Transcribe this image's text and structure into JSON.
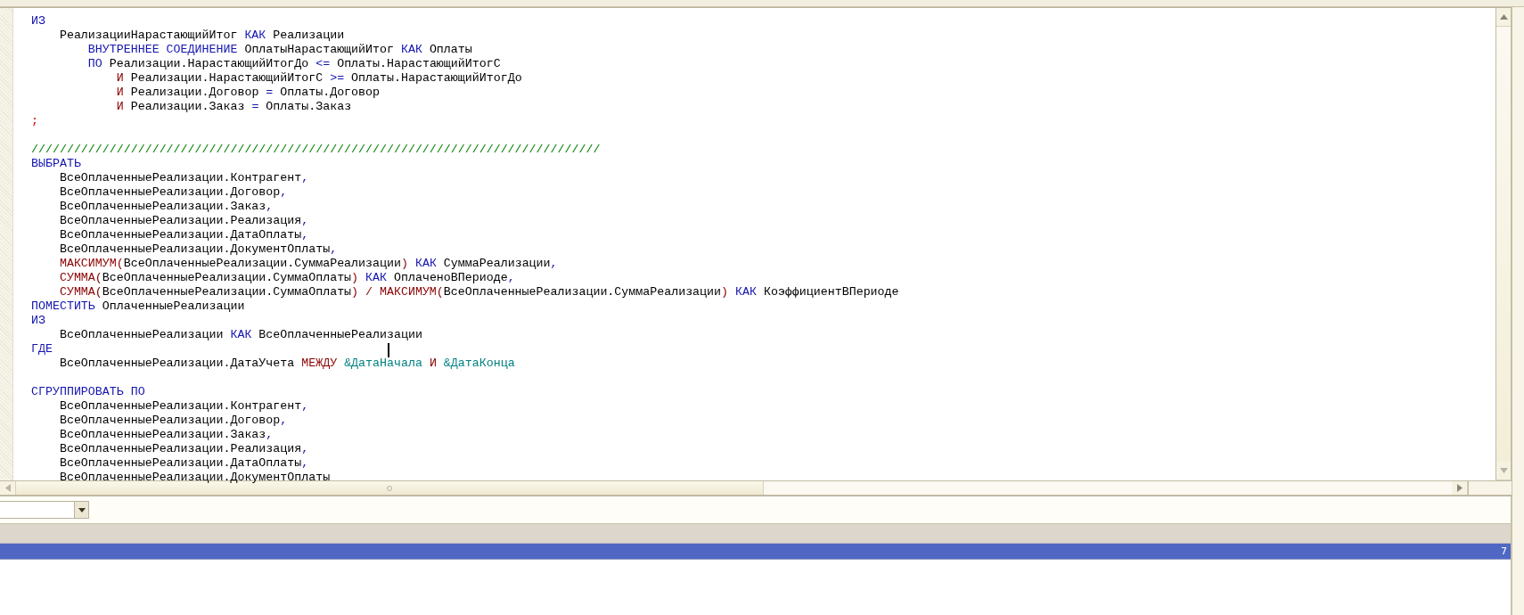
{
  "editor": {
    "lines": [
      {
        "kind": "code",
        "tokens": [
          {
            "kind": "keyword",
            "text": "ИЗ"
          }
        ]
      },
      {
        "kind": "code",
        "tokens": [
          {
            "kind": "plain",
            "text": "    РеализацииНарастающийИтог "
          },
          {
            "kind": "keyword",
            "text": "КАК"
          },
          {
            "kind": "plain",
            "text": " Реализации"
          }
        ]
      },
      {
        "kind": "code",
        "tokens": [
          {
            "kind": "keyword",
            "text": "        ВНУТРЕННЕЕ СОЕДИНЕНИЕ"
          },
          {
            "kind": "plain",
            "text": " ОплатыНарастающийИтог "
          },
          {
            "kind": "keyword",
            "text": "КАК"
          },
          {
            "kind": "plain",
            "text": " Оплаты"
          }
        ]
      },
      {
        "kind": "code",
        "tokens": [
          {
            "kind": "keyword",
            "text": "        ПО"
          },
          {
            "kind": "plain",
            "text": " Реализации.НарастающийИтогДо "
          },
          {
            "kind": "operator",
            "text": "<="
          },
          {
            "kind": "plain",
            "text": " Оплаты.НарастающийИтогС"
          }
        ]
      },
      {
        "kind": "code",
        "tokens": [
          {
            "kind": "function",
            "text": "            И"
          },
          {
            "kind": "plain",
            "text": " Реализации.НарастающийИтогС "
          },
          {
            "kind": "operator",
            "text": ">="
          },
          {
            "kind": "plain",
            "text": " Оплаты.НарастающийИтогДо"
          }
        ]
      },
      {
        "kind": "code",
        "tokens": [
          {
            "kind": "function",
            "text": "            И"
          },
          {
            "kind": "plain",
            "text": " Реализации.Договор "
          },
          {
            "kind": "operator",
            "text": "="
          },
          {
            "kind": "plain",
            "text": " Оплаты.Договор"
          }
        ]
      },
      {
        "kind": "code",
        "tokens": [
          {
            "kind": "function",
            "text": "            И"
          },
          {
            "kind": "plain",
            "text": " Реализации.Заказ "
          },
          {
            "kind": "operator",
            "text": "="
          },
          {
            "kind": "plain",
            "text": " Оплаты.Заказ"
          }
        ]
      },
      {
        "kind": "code",
        "tokens": [
          {
            "kind": "semicolon",
            "text": ";"
          }
        ]
      },
      {
        "kind": "blank"
      },
      {
        "kind": "code",
        "tokens": [
          {
            "kind": "comment",
            "text": "////////////////////////////////////////////////////////////////////////////////"
          }
        ]
      },
      {
        "kind": "code",
        "tokens": [
          {
            "kind": "keyword",
            "text": "ВЫБРАТЬ"
          }
        ]
      },
      {
        "kind": "code",
        "tokens": [
          {
            "kind": "plain",
            "text": "    ВсеОплаченныеРеализации.Контрагент"
          },
          {
            "kind": "operator",
            "text": ","
          }
        ]
      },
      {
        "kind": "code",
        "tokens": [
          {
            "kind": "plain",
            "text": "    ВсеОплаченныеРеализации.Договор"
          },
          {
            "kind": "operator",
            "text": ","
          }
        ]
      },
      {
        "kind": "code",
        "tokens": [
          {
            "kind": "plain",
            "text": "    ВсеОплаченныеРеализации.Заказ"
          },
          {
            "kind": "operator",
            "text": ","
          }
        ]
      },
      {
        "kind": "code",
        "tokens": [
          {
            "kind": "plain",
            "text": "    ВсеОплаченныеРеализации.Реализация"
          },
          {
            "kind": "operator",
            "text": ","
          }
        ]
      },
      {
        "kind": "code",
        "tokens": [
          {
            "kind": "plain",
            "text": "    ВсеОплаченныеРеализации.ДатаОплаты"
          },
          {
            "kind": "operator",
            "text": ","
          }
        ]
      },
      {
        "kind": "code",
        "tokens": [
          {
            "kind": "plain",
            "text": "    ВсеОплаченныеРеализации.ДокументОплаты"
          },
          {
            "kind": "operator",
            "text": ","
          }
        ]
      },
      {
        "kind": "code",
        "tokens": [
          {
            "kind": "function",
            "text": "    МАКСИМУМ("
          },
          {
            "kind": "plain",
            "text": "ВсеОплаченныеРеализации.СуммаРеализации"
          },
          {
            "kind": "function",
            "text": ") "
          },
          {
            "kind": "keyword",
            "text": "КАК"
          },
          {
            "kind": "plain",
            "text": " СуммаРеализации"
          },
          {
            "kind": "operator",
            "text": ","
          }
        ]
      },
      {
        "kind": "code",
        "tokens": [
          {
            "kind": "function",
            "text": "    СУММА("
          },
          {
            "kind": "plain",
            "text": "ВсеОплаченныеРеализации.СуммаОплаты"
          },
          {
            "kind": "function",
            "text": ") "
          },
          {
            "kind": "keyword",
            "text": "КАК"
          },
          {
            "kind": "plain",
            "text": " ОплаченоВПериоде"
          },
          {
            "kind": "operator",
            "text": ","
          }
        ]
      },
      {
        "kind": "code",
        "tokens": [
          {
            "kind": "function",
            "text": "    СУММА("
          },
          {
            "kind": "plain",
            "text": "ВсеОплаченныеРеализации.СуммаОплаты"
          },
          {
            "kind": "function",
            "text": ") / МАКСИМУМ("
          },
          {
            "kind": "plain",
            "text": "ВсеОплаченныеРеализации.СуммаРеализации"
          },
          {
            "kind": "function",
            "text": ") "
          },
          {
            "kind": "keyword",
            "text": "КАК"
          },
          {
            "kind": "plain",
            "text": " КоэффициентВПериоде"
          }
        ]
      },
      {
        "kind": "code",
        "tokens": [
          {
            "kind": "keyword",
            "text": "ПОМЕСТИТЬ"
          },
          {
            "kind": "plain",
            "text": " ОплаченныеРеализации"
          }
        ]
      },
      {
        "kind": "code",
        "tokens": [
          {
            "kind": "keyword",
            "text": "ИЗ"
          }
        ]
      },
      {
        "kind": "code",
        "tokens": [
          {
            "kind": "plain",
            "text": "    ВсеОплаченныеРеализации "
          },
          {
            "kind": "keyword",
            "text": "КАК"
          },
          {
            "kind": "plain",
            "text": " ВсеОплаченныеРеализации"
          }
        ]
      },
      {
        "kind": "code",
        "tokens": [
          {
            "kind": "keyword",
            "text": "ГДЕ"
          }
        ]
      },
      {
        "kind": "code",
        "tokens": [
          {
            "kind": "plain",
            "text": "    ВсеОплаченныеРеализации.ДатаУчета "
          },
          {
            "kind": "function",
            "text": "МЕЖДУ "
          },
          {
            "kind": "parameter",
            "text": "&ДатаНачала"
          },
          {
            "kind": "function",
            "text": " И "
          },
          {
            "kind": "parameter",
            "text": "&ДатаКонца"
          }
        ]
      },
      {
        "kind": "blank"
      },
      {
        "kind": "code",
        "tokens": [
          {
            "kind": "keyword",
            "text": "СГРУППИРОВАТЬ ПО"
          }
        ]
      },
      {
        "kind": "code",
        "tokens": [
          {
            "kind": "plain",
            "text": "    ВсеОплаченныеРеализации.Контрагент"
          },
          {
            "kind": "operator",
            "text": ","
          }
        ]
      },
      {
        "kind": "code",
        "tokens": [
          {
            "kind": "plain",
            "text": "    ВсеОплаченныеРеализации.Договор"
          },
          {
            "kind": "operator",
            "text": ","
          }
        ]
      },
      {
        "kind": "code",
        "tokens": [
          {
            "kind": "plain",
            "text": "    ВсеОплаченныеРеализации.Заказ"
          },
          {
            "kind": "operator",
            "text": ","
          }
        ]
      },
      {
        "kind": "code",
        "tokens": [
          {
            "kind": "plain",
            "text": "    ВсеОплаченныеРеализации.Реализация"
          },
          {
            "kind": "operator",
            "text": ","
          }
        ]
      },
      {
        "kind": "code",
        "tokens": [
          {
            "kind": "plain",
            "text": "    ВсеОплаченныеРеализации.ДатаОплаты"
          },
          {
            "kind": "operator",
            "text": ","
          }
        ]
      },
      {
        "kind": "code",
        "tokens": [
          {
            "kind": "plain",
            "text": "    ВсеОплаченныеРеализации.ДокументОплаты"
          }
        ]
      }
    ]
  },
  "lower_panel": {
    "selected_row": {
      "text": "7"
    }
  }
}
